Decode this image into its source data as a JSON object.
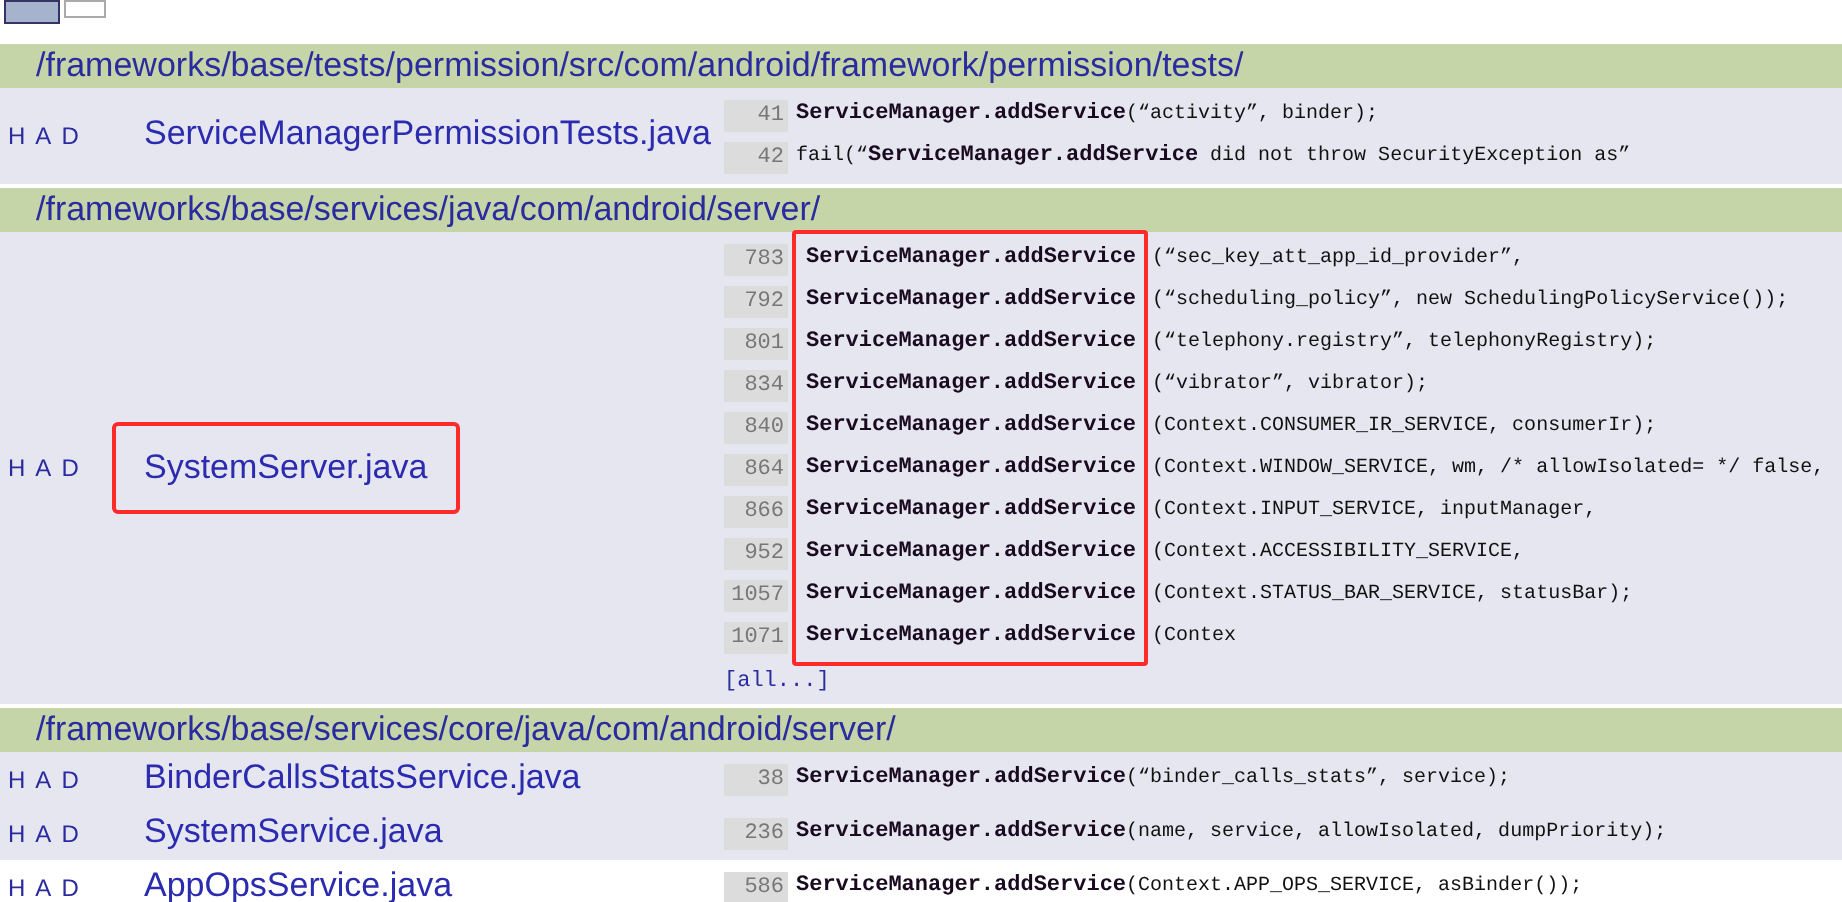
{
  "pager": [
    {
      "selected": true
    },
    {
      "selected": false
    }
  ],
  "groups": [
    {
      "path": "/frameworks/base/tests/permission/src/com/android/framework/permission/tests/",
      "files": [
        {
          "history": "H",
          "annotate": "A",
          "download": "D",
          "name": "ServiceManagerPermissionTests.java",
          "highlighted": false,
          "hits": [
            {
              "line": "41",
              "code": "**ServiceManager.addService**(“activity”, binder);"
            },
            {
              "line": "42",
              "code": "fail(“**ServiceManager.addService** did not throw SecurityException as”"
            }
          ]
        }
      ]
    },
    {
      "path": "/frameworks/base/services/java/com/android/server/",
      "files": [
        {
          "history": "H",
          "annotate": "A",
          "download": "D",
          "name": "SystemServer.java",
          "highlighted": true,
          "more": "[all...]",
          "hits": [
            {
              "line": "783",
              "code": "**ServiceManager.addService**(“sec_key_att_app_id_provider”,"
            },
            {
              "line": "792",
              "code": "**ServiceManager.addService**(“scheduling_policy”, new SchedulingPolicyService());"
            },
            {
              "line": "801",
              "code": "**ServiceManager.addService**(“telephony.registry”, telephonyRegistry);"
            },
            {
              "line": "834",
              "code": "**ServiceManager.addService**(“vibrator”, vibrator);"
            },
            {
              "line": "840",
              "code": "**ServiceManager.addService**(Context.CONSUMER_IR_SERVICE, consumerIr);"
            },
            {
              "line": "864",
              "code": "**ServiceManager.addService**(Context.WINDOW_SERVICE, wm, /* allowIsolated= */ false,"
            },
            {
              "line": "866",
              "code": "**ServiceManager.addService**(Context.INPUT_SERVICE, inputManager,"
            },
            {
              "line": "952",
              "code": "**ServiceManager.addService**(Context.ACCESSIBILITY_SERVICE,"
            },
            {
              "line": "1057",
              "code": "**ServiceManager.addService**(Context.STATUS_BAR_SERVICE, statusBar);"
            },
            {
              "line": "1071",
              "code": "**ServiceManager.addService**(Contex"
            }
          ]
        }
      ]
    },
    {
      "path": "/frameworks/base/services/core/java/com/android/server/",
      "files": [
        {
          "history": "H",
          "annotate": "A",
          "download": "D",
          "name": "BinderCallsStatsService.java",
          "highlighted": false,
          "hits": [
            {
              "line": "38",
              "code": "**ServiceManager.addService**(“binder_calls_stats”, service);"
            }
          ]
        },
        {
          "history": "H",
          "annotate": "A",
          "download": "D",
          "name": "SystemService.java",
          "highlighted": false,
          "hits": [
            {
              "line": "236",
              "code": "**ServiceManager.addService**(name, service, allowIsolated, dumpPriority);"
            }
          ]
        },
        {
          "history": "H",
          "annotate": "A",
          "download": "D",
          "name": "AppOpsService.java",
          "highlighted": false,
          "hits": [
            {
              "line": "586",
              "code": "**ServiceManager.addService**(Context.APP_OPS_SERVICE, asBinder());"
            }
          ]
        }
      ]
    }
  ]
}
